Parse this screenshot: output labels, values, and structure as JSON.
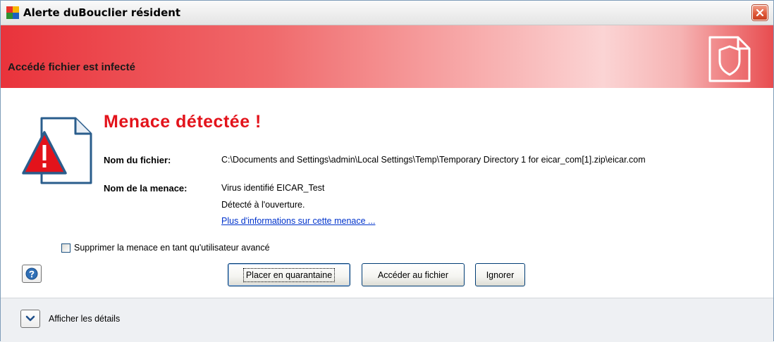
{
  "window": {
    "title": "Alerte duBouclier résident"
  },
  "banner": {
    "title": "Accédé fichier est infecté"
  },
  "alert": {
    "headline": "Menace détectée !",
    "file_label": "Nom du fichier:",
    "file_value": "C:\\Documents and Settings\\admin\\Local Settings\\Temp\\Temporary Directory 1 for eicar_com[1].zip\\eicar.com",
    "threat_label": "Nom de la menace:",
    "threat_value": "Virus identifié EICAR_Test",
    "detected_text": "Détecté à l'ouverture.",
    "more_info_link": "Plus d'informations sur cette menace ..."
  },
  "options": {
    "advanced_delete_label": "Supprimer la menace en tant qu'utilisateur avancé",
    "advanced_delete_checked": false
  },
  "buttons": {
    "quarantine_label": "Placer en quarantaine",
    "access_label": "Accéder au fichier",
    "ignore_label": "Ignorer"
  },
  "footer": {
    "details_label": "Afficher les détails"
  },
  "icons": {
    "app": "avg-app-icon",
    "close": "close-icon",
    "shield": "shield-icon",
    "warning": "warning-document-icon",
    "help": "help-icon",
    "expand": "chevron-down-icon"
  },
  "colors": {
    "headline": "#e3131b",
    "banner_red": "#e9333b",
    "link": "#0033cc"
  }
}
